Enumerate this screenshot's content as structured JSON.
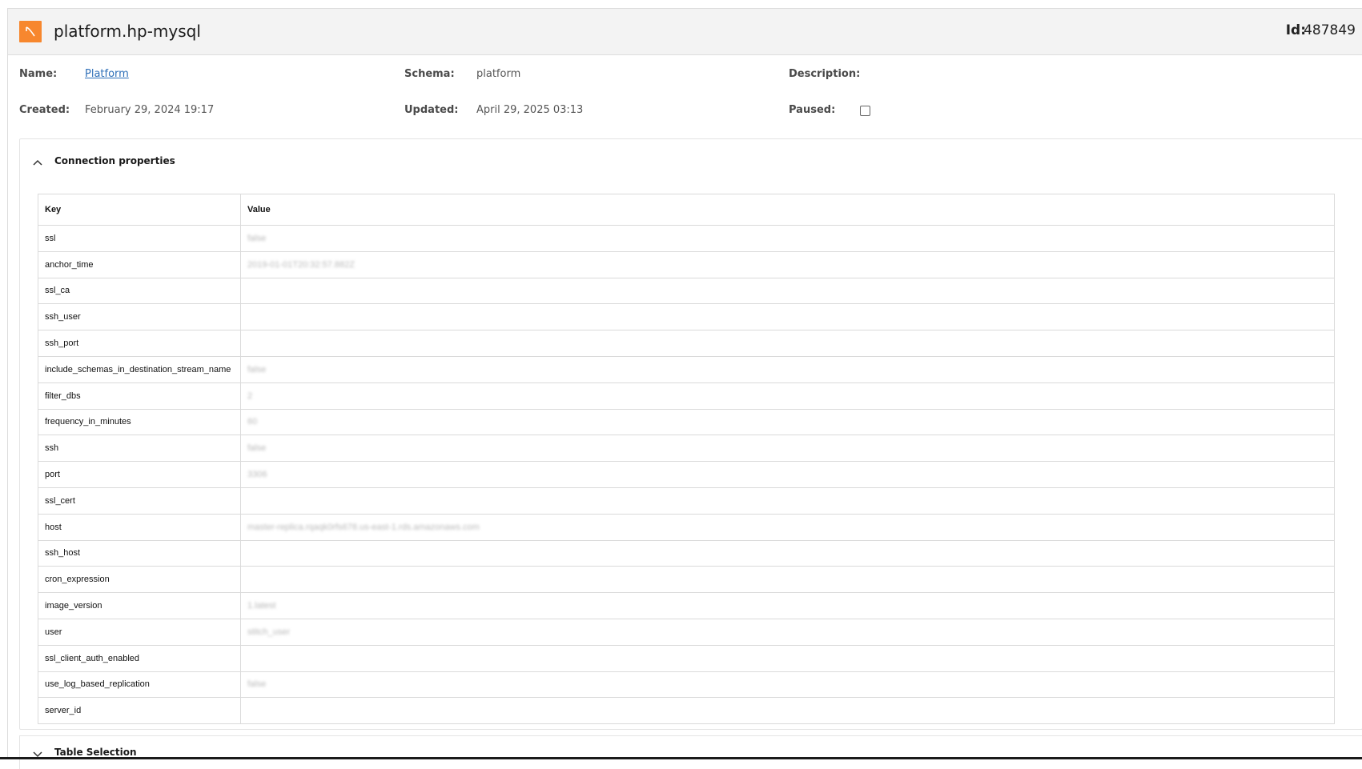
{
  "header": {
    "title": "platform.hp-mysql",
    "icon": "mysql-logo-icon",
    "accent_color": "#f7872e",
    "id_label": "Id:",
    "id_value": "487849"
  },
  "meta": {
    "name_label": "Name:",
    "name_value": "Platform",
    "schema_label": "Schema:",
    "schema_value": "platform",
    "description_label": "Description:",
    "description_value": "",
    "created_label": "Created:",
    "created_value": "February 29, 2024 19:17",
    "updated_label": "Updated:",
    "updated_value": "April 29, 2025 03:13",
    "paused_label": "Paused:",
    "paused_checked": false
  },
  "connection": {
    "title": "Connection properties",
    "expanded": true,
    "columns": [
      "Key",
      "Value"
    ],
    "rows": [
      {
        "key": "ssl",
        "value": "false"
      },
      {
        "key": "anchor_time",
        "value": "2019-01-01T20:32:57.882Z"
      },
      {
        "key": "ssl_ca",
        "value": ""
      },
      {
        "key": "ssh_user",
        "value": ""
      },
      {
        "key": "ssh_port",
        "value": ""
      },
      {
        "key": "include_schemas_in_destination_stream_name",
        "value": "false"
      },
      {
        "key": "filter_dbs",
        "value": "2"
      },
      {
        "key": "frequency_in_minutes",
        "value": "60"
      },
      {
        "key": "ssh",
        "value": "false"
      },
      {
        "key": "port",
        "value": "3306"
      },
      {
        "key": "ssl_cert",
        "value": ""
      },
      {
        "key": "host",
        "value": "master-replica.rqaqk0rfs678.us-east-1.rds.amazonaws.com"
      },
      {
        "key": "ssh_host",
        "value": ""
      },
      {
        "key": "cron_expression",
        "value": ""
      },
      {
        "key": "image_version",
        "value": "1.latest"
      },
      {
        "key": "user",
        "value": "stitch_user"
      },
      {
        "key": "ssl_client_auth_enabled",
        "value": ""
      },
      {
        "key": "use_log_based_replication",
        "value": "false"
      },
      {
        "key": "server_id",
        "value": ""
      }
    ]
  },
  "table_selection": {
    "title": "Table Selection",
    "expanded": false
  }
}
